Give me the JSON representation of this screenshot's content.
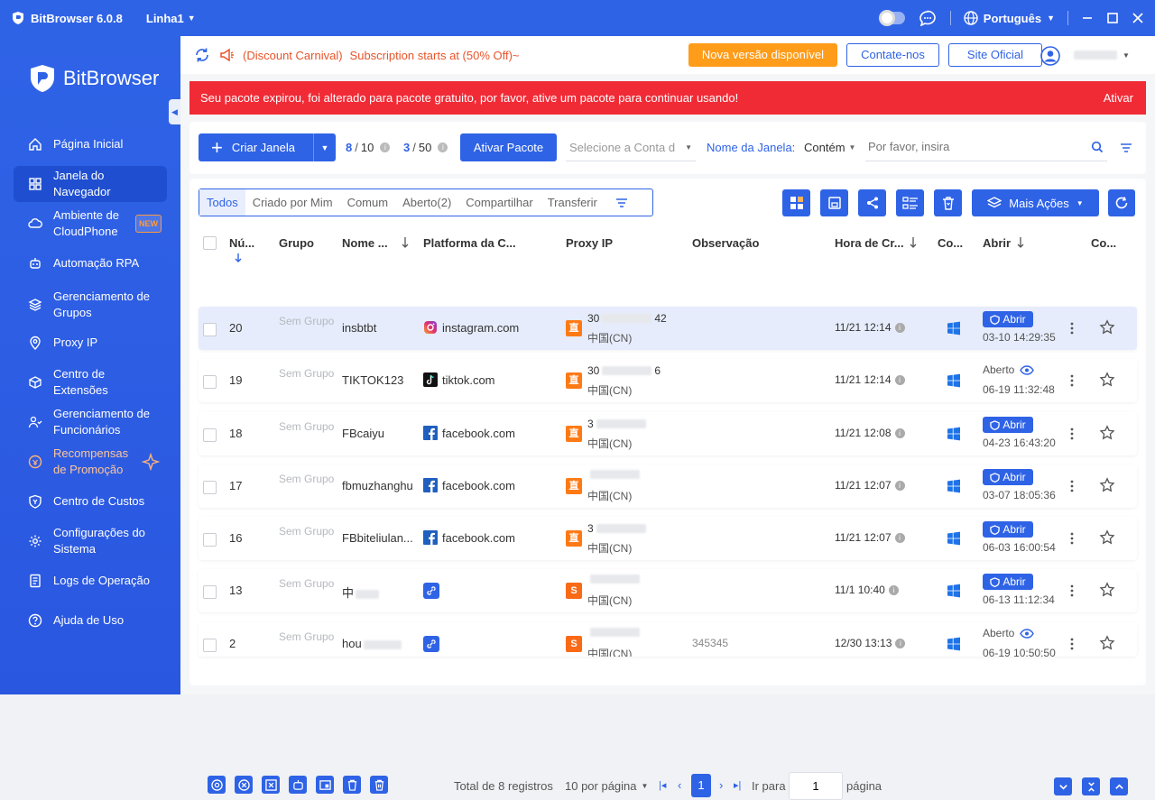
{
  "app": {
    "title": "BitBrowser 6.0.8",
    "line": "Linha1",
    "language": "Português"
  },
  "sidebar": {
    "brand": "BitBrowser",
    "items": [
      {
        "label": "Página Inicial",
        "icon": "home-icon"
      },
      {
        "label": "Janela do Navegador",
        "icon": "grid-icon",
        "active": true
      },
      {
        "label": "Ambiente de CloudPhone",
        "icon": "cloud-icon",
        "badge": "NEW"
      },
      {
        "label": "Automação RPA",
        "icon": "robot-icon"
      },
      {
        "label": "Gerenciamento de Grupos",
        "icon": "layers-icon"
      },
      {
        "label": "Proxy IP",
        "icon": "location-icon"
      },
      {
        "label": "Centro de Extensões",
        "icon": "cube-icon"
      },
      {
        "label": "Gerenciamento de Funcionários",
        "icon": "users-icon"
      },
      {
        "label": "Recompensas de Promoção",
        "icon": "coin-icon"
      },
      {
        "label": "Centro de Custos",
        "icon": "shield-icon"
      },
      {
        "label": "Configurações do Sistema",
        "icon": "gear-icon"
      },
      {
        "label": "Logs de Operação",
        "icon": "log-icon"
      },
      {
        "label": "Ajuda de Uso",
        "icon": "help-icon"
      }
    ]
  },
  "topbar": {
    "discount_tag": "(Discount Carnival)",
    "discount_text": "Subscription starts at (50% Off)~",
    "new_version": "Nova versão disponível",
    "contact": "Contate-nos",
    "official": "Site Oficial"
  },
  "alert": {
    "text": "Seu pacote expirou, foi alterado para pacote gratuito, por favor, ative um pacote para continuar usando!",
    "action": "Ativar"
  },
  "toolbar": {
    "create": "Criar Janela",
    "windows_used": "8",
    "windows_total": "10",
    "members_used": "3",
    "members_total": "50",
    "activate": "Ativar Pacote",
    "account_placeholder": "Selecione a Conta d",
    "name_label": "Nome da Janela:",
    "match": "Contém",
    "search_placeholder": "Por favor, insira"
  },
  "tabs": [
    "Todos",
    "Criado por Mim",
    "Comum",
    "Aberto(2)",
    "Compartilhar",
    "Transferir"
  ],
  "more_actions": "Mais Ações",
  "columns": {
    "num": "Nú...",
    "group": "Grupo",
    "name": "Nome ...",
    "platform": "Platforma da C...",
    "proxy": "Proxy IP",
    "note": "Observação",
    "created": "Hora de Cr...",
    "os": "Co...",
    "open": "Abrir",
    "co": "Co..."
  },
  "rows": [
    {
      "num": "20",
      "group": "Sem Grupo",
      "name": "insbtbt",
      "platform": "instagram.com",
      "picon": "instagram-icon",
      "proxy_type": "直",
      "ip_a": "30",
      "ip_b": "42",
      "region": "中国(CN)",
      "note": "",
      "created": "11/21 12:14",
      "status": "button",
      "open_label": "Abrir",
      "last": "03-10 14:29:35",
      "selected": true
    },
    {
      "num": "19",
      "group": "Sem Grupo",
      "name": "TIKTOK123",
      "platform": "tiktok.com",
      "picon": "tiktok-icon",
      "proxy_type": "直",
      "ip_a": "30",
      "ip_b": "6",
      "region": "中国(CN)",
      "note": "",
      "created": "11/21 12:14",
      "status": "text",
      "open_label": "Aberto",
      "last": "06-19 11:32:48"
    },
    {
      "num": "18",
      "group": "Sem Grupo",
      "name": "FBcaiyu",
      "platform": "facebook.com",
      "picon": "facebook-icon",
      "proxy_type": "直",
      "ip_a": "3",
      "ip_b": "",
      "region": "中国(CN)",
      "note": "",
      "created": "11/21 12:08",
      "status": "button",
      "open_label": "Abrir",
      "last": "04-23 16:43:20"
    },
    {
      "num": "17",
      "group": "Sem Grupo",
      "name": "fbmuzhanghu",
      "platform": "facebook.com",
      "picon": "facebook-icon",
      "proxy_type": "直",
      "ip_a": "",
      "ip_b": "",
      "region": "中国(CN)",
      "note": "",
      "created": "11/21 12:07",
      "status": "button",
      "open_label": "Abrir",
      "last": "03-07 18:05:36"
    },
    {
      "num": "16",
      "group": "Sem Grupo",
      "name": "FBbiteliulan...",
      "platform": "facebook.com",
      "picon": "facebook-icon",
      "proxy_type": "直",
      "ip_a": "3",
      "ip_b": "",
      "region": "中国(CN)",
      "note": "",
      "created": "11/21 12:07",
      "status": "button",
      "open_label": "Abrir",
      "last": "06-03 16:00:54"
    },
    {
      "num": "13",
      "group": "Sem Grupo",
      "name": "中",
      "platform": "",
      "picon": "link-icon",
      "proxy_type": "S",
      "ip_a": "",
      "ip_b": "",
      "region": "中国(CN)",
      "note": "",
      "created": "11/1 10:40",
      "status": "button",
      "open_label": "Abrir",
      "last": "06-13 11:12:34"
    },
    {
      "num": "2",
      "group": "Sem Grupo",
      "name": "hou",
      "platform": "",
      "picon": "link-icon",
      "proxy_type": "S",
      "ip_a": "",
      "ip_b": "",
      "region": "中国(CN)",
      "note": "345345",
      "created": "12/30 13:13",
      "status": "text",
      "open_label": "Aberto",
      "last": "06-19 10:50:50"
    }
  ],
  "pagination": {
    "total": "Total de 8 registros",
    "per_page": "10 por página",
    "current": "1",
    "goto": "Ir para",
    "goto_value": "1",
    "page_word": "página"
  },
  "colors": {
    "primary": "#2f63e6",
    "alert": "#f12b36",
    "orange": "#ff9c1a",
    "windows": "#1e73e8"
  }
}
